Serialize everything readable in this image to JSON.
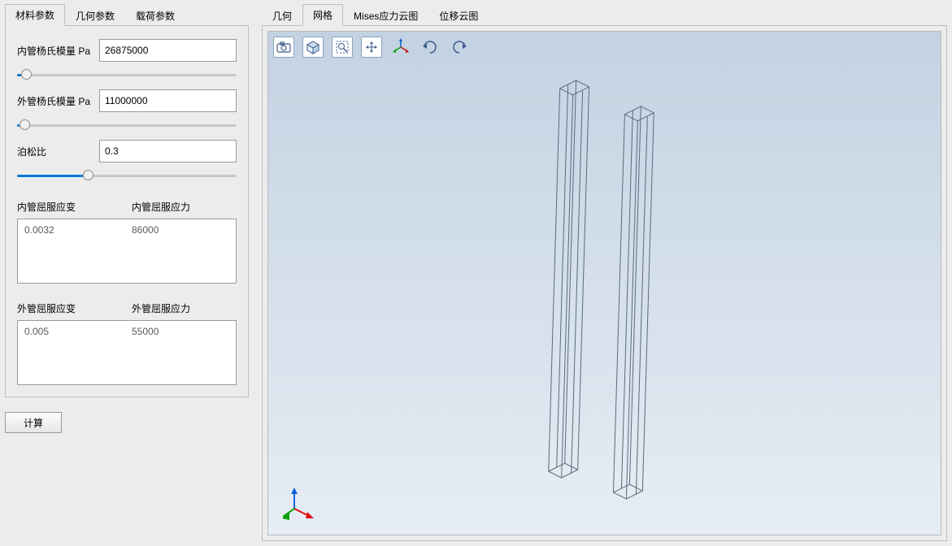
{
  "left_tabs": [
    {
      "id": "material",
      "label": "材料参数",
      "active": true
    },
    {
      "id": "geometry",
      "label": "几何参数",
      "active": false
    },
    {
      "id": "load",
      "label": "载荷参数",
      "active": false
    }
  ],
  "params": {
    "inner_modulus_label": "内管杨氏模量 Pa",
    "inner_modulus_value": "26875000",
    "inner_modulus_slider_pct": 2,
    "outer_modulus_label": "外管杨氏模量 Pa",
    "outer_modulus_value": "11000000",
    "outer_modulus_slider_pct": 1,
    "poisson_label": "泊松比",
    "poisson_value": "0.3",
    "poisson_slider_pct": 30
  },
  "yield_inner": {
    "strain_label": "内管屈服应变",
    "stress_label": "内管屈服应力",
    "strain_value": "0.0032",
    "stress_value": "86000"
  },
  "yield_outer": {
    "strain_label": "外管屈服应变",
    "stress_label": "外管屈服应力",
    "strain_value": "0.005",
    "stress_value": "55000"
  },
  "calc_button": "计算",
  "right_tabs": [
    {
      "id": "geom",
      "label": "几何",
      "active": false
    },
    {
      "id": "mesh",
      "label": "网格",
      "active": true
    },
    {
      "id": "mises",
      "label": "Mises应力云图",
      "active": false
    },
    {
      "id": "disp",
      "label": "位移云图",
      "active": false
    }
  ],
  "toolbar_icons": [
    "camera-icon",
    "isometric-cube-icon",
    "zoom-window-icon",
    "pan-icon",
    "axes-icon",
    "rotate-left-icon",
    "rotate-right-icon"
  ]
}
